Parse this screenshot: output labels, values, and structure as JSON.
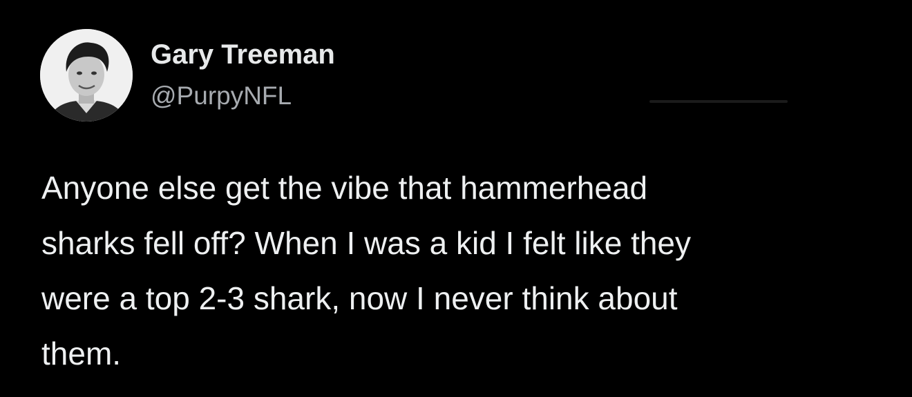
{
  "tweet": {
    "author": {
      "display_name": "Gary Treeman",
      "handle": "@PurpyNFL",
      "avatar_icon": "profile-photo"
    },
    "text": "Anyone else get the vibe that hammerhead\nsharks fell off? When I was a kid I felt like they\nwere a top 2-3 shark, now I never think about\nthem."
  },
  "colors": {
    "background": "#000000",
    "text_primary": "#e7e9ea",
    "text_secondary": "#a7abb0"
  }
}
